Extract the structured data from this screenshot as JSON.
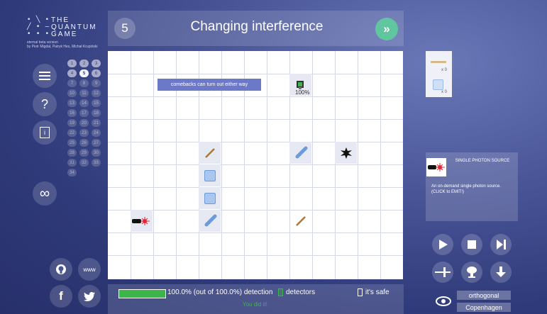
{
  "logo": {
    "lines": [
      {
        "symbols": "• ╲ •",
        "word": "THE"
      },
      {
        "symbols": "╱ • —",
        "word": "QUANTUM"
      },
      {
        "symbols": "• • •",
        "word": "GAME"
      }
    ],
    "subtitle1": "eternal beta version",
    "subtitle2": "by Piotr Migdał, Patryk Hes, Michał Krupiński"
  },
  "sidebar": {
    "menu_icon": "hamburger-icon",
    "help_label": "?",
    "info_label": "i",
    "infinity_label": "∞",
    "www_label": "www",
    "github_icon": "github-icon",
    "facebook_label": "f",
    "twitter_icon": "twitter-icon"
  },
  "levels": {
    "items": [
      "1",
      "2",
      "3",
      "4",
      "5",
      "6",
      "7",
      "8",
      "9",
      "10",
      "11",
      "12",
      "13",
      "14",
      "15",
      "16",
      "17",
      "18",
      "19",
      "20",
      "21",
      "22",
      "23",
      "24",
      "25",
      "26",
      "27",
      "28",
      "29",
      "30",
      "31",
      "32",
      "33",
      "34"
    ],
    "done": [
      "1",
      "2",
      "3",
      "4",
      "6"
    ],
    "current": "5"
  },
  "header": {
    "level_number": "5",
    "title": "Changing interference",
    "next_label": "»"
  },
  "board": {
    "hint": "comebacks can turn out either way",
    "detector_percent": "100%"
  },
  "footer": {
    "progress_fraction": 1.0,
    "detection_text": "100.0% (out of 100.0%) detection",
    "detectors_label": "detectors",
    "safe_label": "it's safe",
    "success_text": "You did it!"
  },
  "toolbox": {
    "mirror_count": "x 0",
    "glass_count": "x 0"
  },
  "info_panel": {
    "name": "SINGLE PHOTON SOURCE",
    "description": "An on-demand single photon source. (CLICK to EMIT!)"
  },
  "controls": {
    "play_icon": "play-icon",
    "stop_icon": "stop-icon",
    "step_icon": "step-forward-icon",
    "ket_icon": "ket-view-icon",
    "explosion_icon": "mushroom-cloud-icon",
    "download_icon": "download-icon",
    "eye_icon": "eye-icon",
    "mode1": "orthogonal",
    "mode2": "Copenhagen"
  },
  "colors": {
    "accent_green": "#5fc6a0",
    "progress_green": "#3cb54a",
    "hint_bg": "#6c78c8",
    "element_blue": "#6f9bd8"
  }
}
